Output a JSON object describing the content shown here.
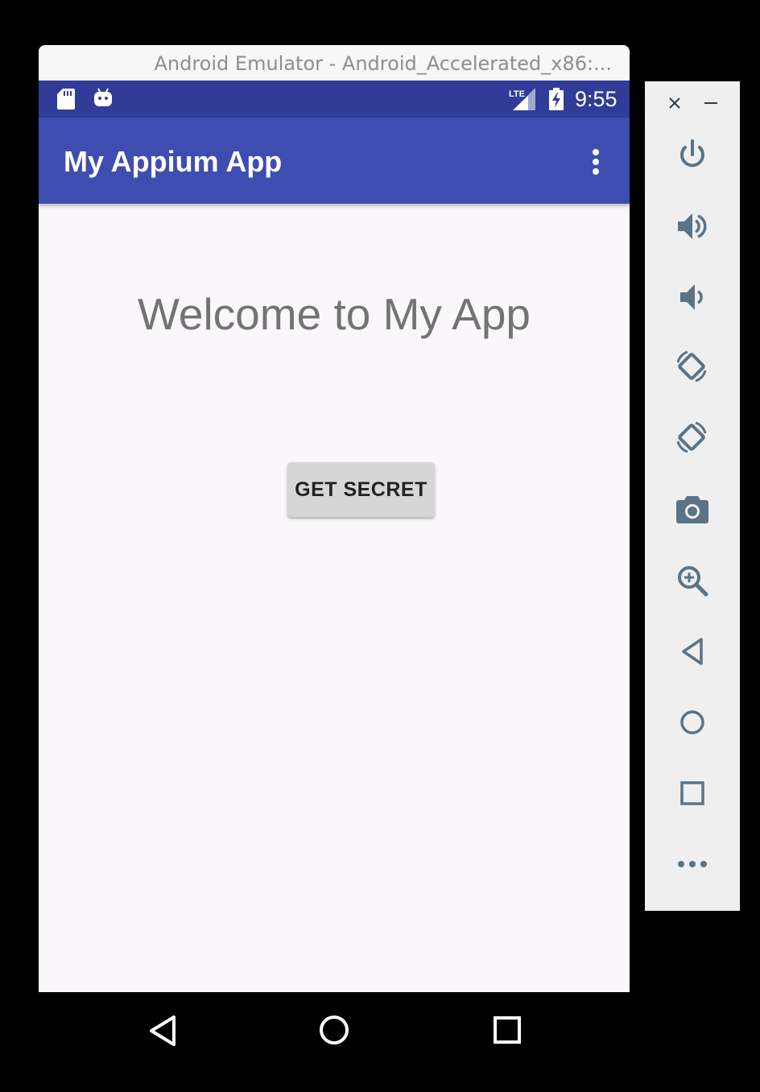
{
  "window": {
    "title": "Android Emulator - Android_Accelerated_x86:..."
  },
  "status_bar": {
    "time": "9:55",
    "network_label": "LTE",
    "icons": [
      "sd-card-icon",
      "android-icon",
      "lte-signal-icon",
      "battery-charging-icon"
    ]
  },
  "app_bar": {
    "title": "My Appium App",
    "overflow_icon": "more-vert-icon"
  },
  "main": {
    "welcome_text": "Welcome to My App",
    "button_label": "GET SECRET"
  },
  "nav_bar": {
    "buttons": [
      "back-icon",
      "home-icon",
      "recents-icon"
    ]
  },
  "side_panel": {
    "window_controls": [
      "close-icon",
      "minimize-icon"
    ],
    "tools": [
      "power-icon",
      "volume-up-icon",
      "volume-down-icon",
      "rotate-left-icon",
      "rotate-right-icon",
      "camera-icon",
      "zoom-icon",
      "back-icon",
      "home-icon",
      "overview-icon",
      "more-icon"
    ]
  },
  "colors": {
    "status_bar": "#303c98",
    "app_bar": "#3f4db0",
    "content_background": "#f9f7f9",
    "button_background": "#d6d6d6",
    "side_icon": "#5a7486"
  }
}
